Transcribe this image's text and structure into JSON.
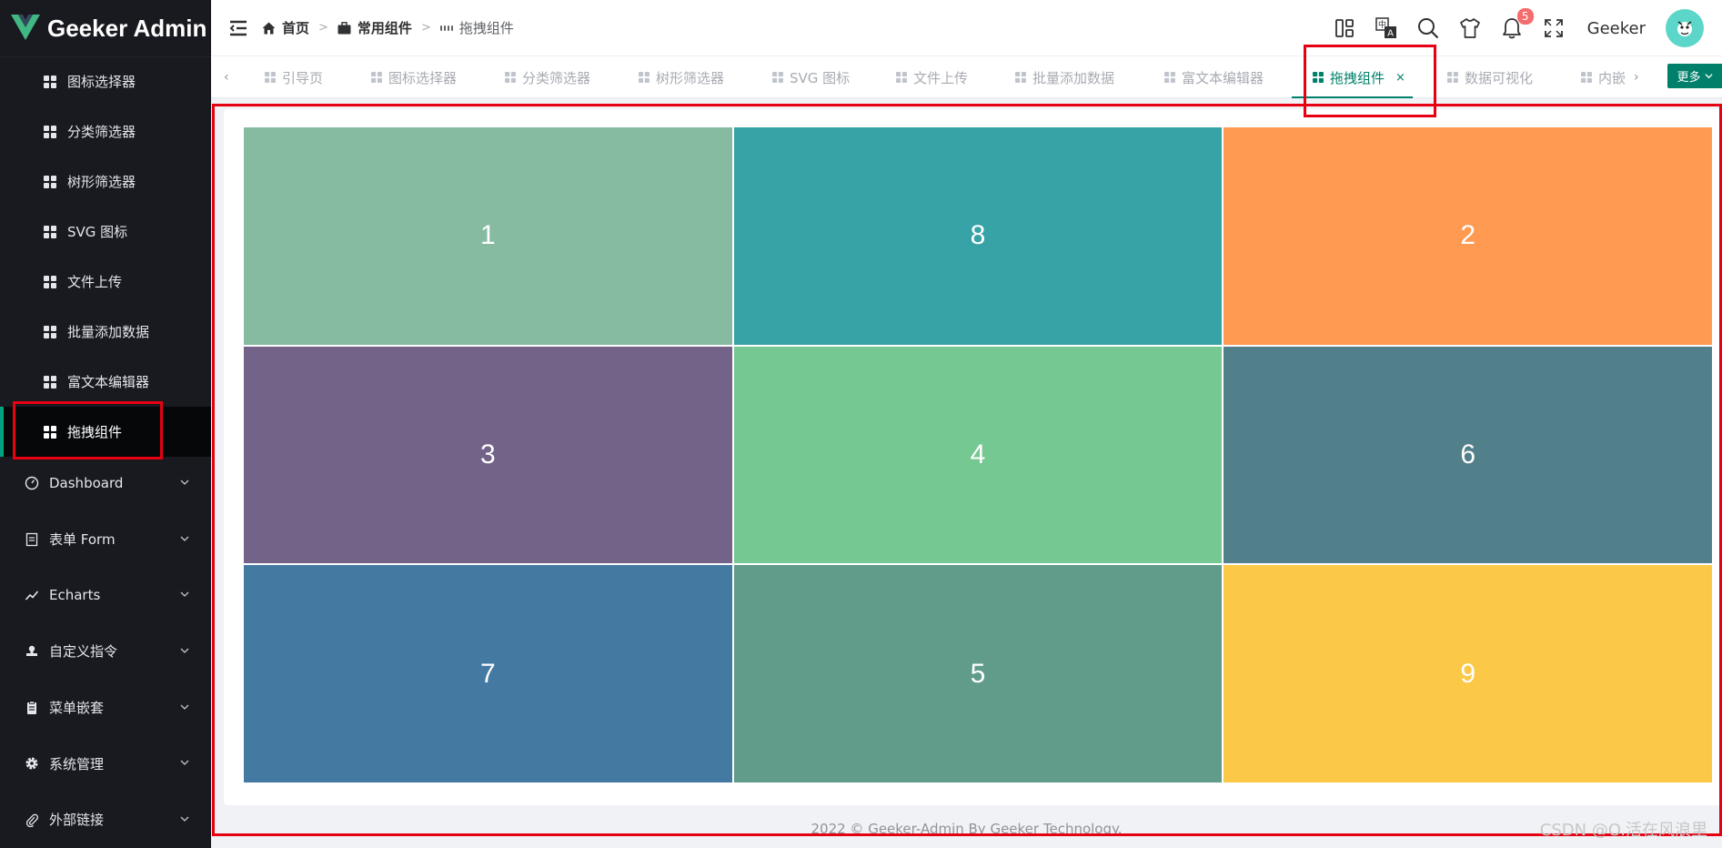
{
  "app": {
    "title": "Geeker Admin",
    "accent_color": "#00806a"
  },
  "sidebar": {
    "sub_items": [
      {
        "label": "图标选择器",
        "icon": "grid-icon",
        "active": false
      },
      {
        "label": "分类筛选器",
        "icon": "grid-icon",
        "active": false
      },
      {
        "label": "树形筛选器",
        "icon": "grid-icon",
        "active": false
      },
      {
        "label": "SVG 图标",
        "icon": "grid-icon",
        "active": false
      },
      {
        "label": "文件上传",
        "icon": "grid-icon",
        "active": false
      },
      {
        "label": "批量添加数据",
        "icon": "grid-icon",
        "active": false
      },
      {
        "label": "富文本编辑器",
        "icon": "grid-icon",
        "active": false
      },
      {
        "label": "拖拽组件",
        "icon": "grid-icon",
        "active": true
      }
    ],
    "menu_items": [
      {
        "label": "Dashboard",
        "icon": "odometer-icon"
      },
      {
        "label": "表单 Form",
        "icon": "tickets-icon"
      },
      {
        "label": "Echarts",
        "icon": "trend-chart-icon"
      },
      {
        "label": "自定义指令",
        "icon": "stamp-icon"
      },
      {
        "label": "菜单嵌套",
        "icon": "list-icon"
      },
      {
        "label": "系统管理",
        "icon": "gear-icon"
      },
      {
        "label": "外部链接",
        "icon": "paperclip-icon"
      }
    ]
  },
  "header": {
    "breadcrumb": [
      {
        "label": "首页",
        "icon": "home-icon"
      },
      {
        "label": "常用组件",
        "icon": "briefcase-icon"
      },
      {
        "label": "拖拽组件",
        "icon": "grid-icon"
      }
    ],
    "notification_count": "5",
    "username": "Geeker"
  },
  "tabs": {
    "items": [
      {
        "label": "引导页"
      },
      {
        "label": "图标选择器"
      },
      {
        "label": "分类筛选器"
      },
      {
        "label": "树形筛选器"
      },
      {
        "label": "SVG 图标"
      },
      {
        "label": "文件上传"
      },
      {
        "label": "批量添加数据"
      },
      {
        "label": "富文本编辑器"
      },
      {
        "label": "拖拽组件",
        "active": true
      },
      {
        "label": "数据可视化"
      },
      {
        "label": "内嵌"
      }
    ],
    "close_symbol": "×",
    "more_label": "更多"
  },
  "draggable_grid": {
    "cells": [
      {
        "label": "1",
        "color": "#86bba1"
      },
      {
        "label": "8",
        "color": "#37a3a6"
      },
      {
        "label": "2",
        "color": "#fe9a52"
      },
      {
        "label": "3",
        "color": "#736389"
      },
      {
        "label": "4",
        "color": "#76c893"
      },
      {
        "label": "6",
        "color": "#52808a"
      },
      {
        "label": "7",
        "color": "#447aa1"
      },
      {
        "label": "5",
        "color": "#619c8b"
      },
      {
        "label": "9",
        "color": "#fcc847"
      }
    ]
  },
  "footer": {
    "text": "2022 © Geeker-Admin By Geeker Technology."
  },
  "watermark": "CSDN @O.活在风浪里"
}
